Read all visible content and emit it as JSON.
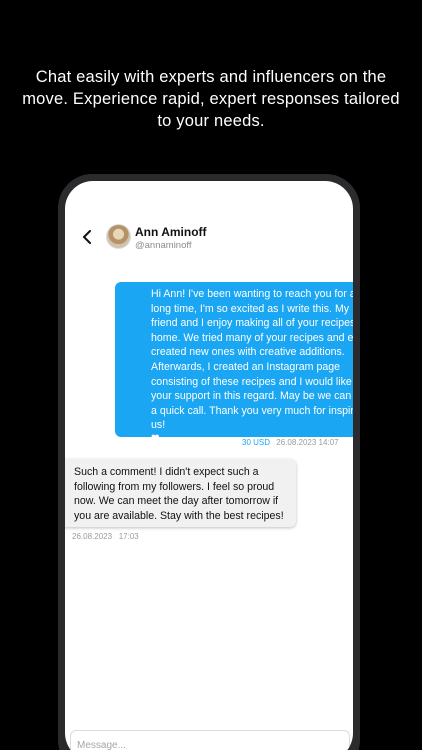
{
  "promo": {
    "text": "Chat easily with experts and influencers on the move. Experience rapid, expert responses tailored to your needs."
  },
  "chat_header": {
    "name": "Ann Aminoff",
    "handle": "@annaminoff",
    "back_icon": "chevron-left-icon",
    "avatar_icon": "avatar"
  },
  "messages": [
    {
      "direction": "outgoing",
      "text": "Hi Ann! I've been wanting to reach you for a long time, I'm so excited as I write this. My friend and I enjoy making all of your recipes at home. We tried many of your recipes and even created new ones with creative additions. Afterwards, I created an Instagram page consisting of these recipes and I would like your support in this regard. May be we can set a quick call. Thank you very much for inspiring us!",
      "emoji": "❤",
      "price": "30 USD",
      "date": "26.08.2023",
      "time": "14:07"
    },
    {
      "direction": "incoming",
      "text": "Such a comment! I didn't expect such a following from my followers. I feel so proud now. We can meet the day after tomorrow if you are available. Stay with the best recipes!",
      "date": "26.08.2023",
      "time": "17:03"
    }
  ],
  "composer": {
    "placeholder": "Message...",
    "value": ""
  },
  "colors": {
    "background": "#000000",
    "accent": "#1aa6f2",
    "incoming_bubble": "#f1f1f1"
  }
}
